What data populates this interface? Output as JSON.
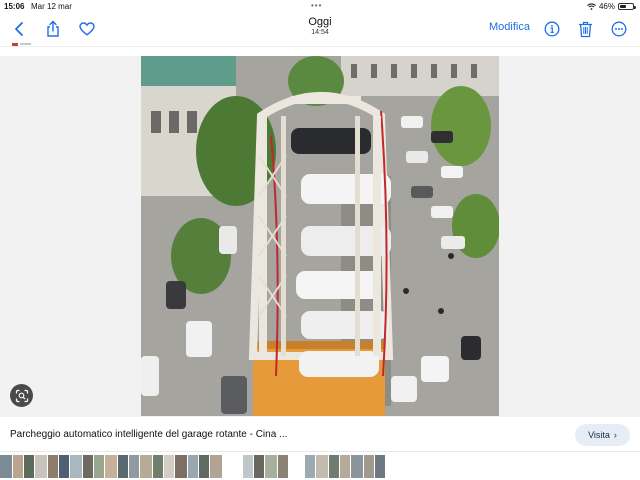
{
  "status_bar": {
    "time": "15:06",
    "date": "Mar 12 mar",
    "battery_label": "46%",
    "battery_level": 0.46
  },
  "toolbar": {
    "title": "Oggi",
    "subtitle": "14:54",
    "edit_label": "Modifica"
  },
  "caption": {
    "text": "Parcheggio automatico intelligente del garage rotante - Cina ...",
    "visit_label": "Visita",
    "visit_chevron": "›"
  },
  "colors": {
    "accent": "#1e6ee8",
    "tower": "#ece7de",
    "tower_base": "#e69a3a"
  },
  "icons": [
    "back-chevron-icon",
    "share-icon",
    "heart-icon",
    "info-icon",
    "trash-icon",
    "more-icon",
    "wifi-icon",
    "battery-icon",
    "visual-lookup-icon"
  ]
}
